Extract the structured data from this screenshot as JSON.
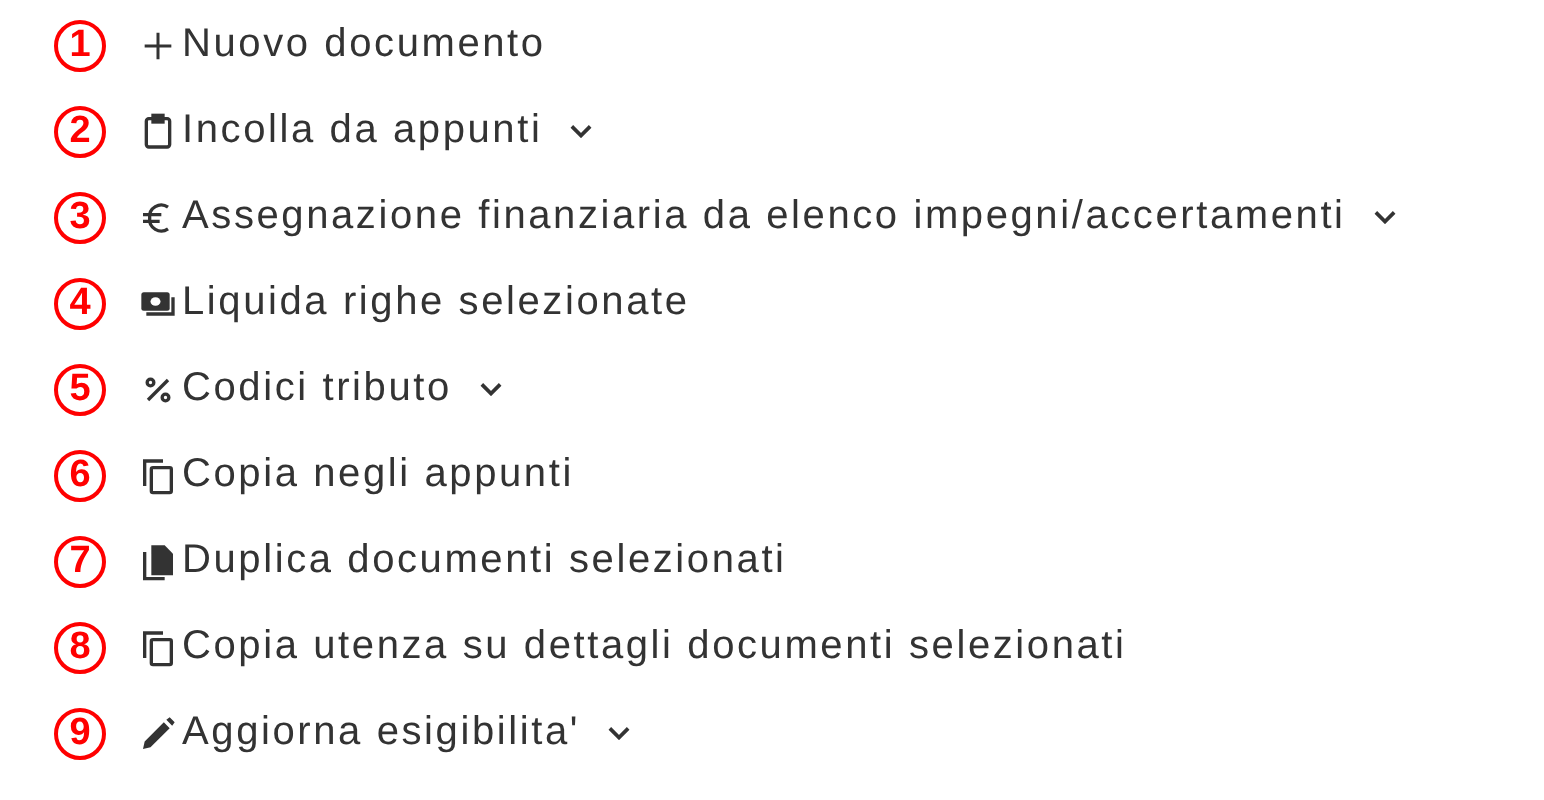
{
  "menu_items": [
    {
      "marker": "1",
      "kind": "plus",
      "label": "Nuovo documento",
      "dropdown": false
    },
    {
      "marker": "2",
      "kind": "clipboard",
      "label": "Incolla da appunti",
      "dropdown": true
    },
    {
      "marker": "3",
      "kind": "euro",
      "label": "Assegnazione finanziaria da elenco impegni/accertamenti",
      "dropdown": true
    },
    {
      "marker": "4",
      "kind": "cash",
      "label": "Liquida righe selezionate",
      "dropdown": false
    },
    {
      "marker": "5",
      "kind": "percent",
      "label": "Codici tributo",
      "dropdown": true
    },
    {
      "marker": "6",
      "kind": "copy",
      "label": "Copia negli appunti",
      "dropdown": false
    },
    {
      "marker": "7",
      "kind": "file-copy",
      "label": "Duplica documenti selezionati",
      "dropdown": false
    },
    {
      "marker": "8",
      "kind": "copy",
      "label": "Copia utenza su dettagli documenti selezionati",
      "dropdown": false
    },
    {
      "marker": "9",
      "kind": "pencil",
      "label": "Aggiorna esigibilita'",
      "dropdown": true
    }
  ]
}
